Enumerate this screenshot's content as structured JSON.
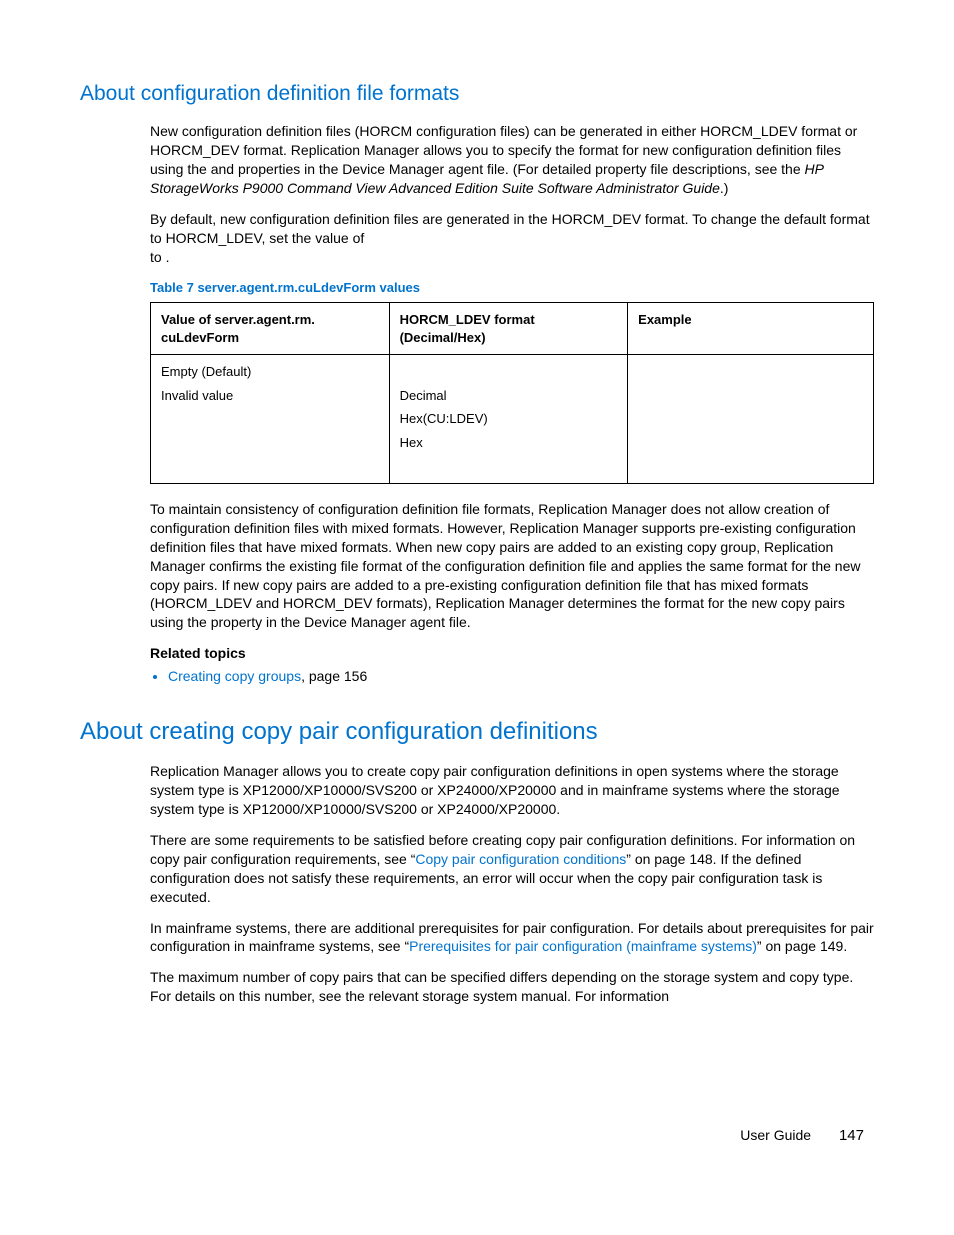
{
  "section1": {
    "heading": "About configuration definition file formats",
    "para1a": "New configuration definition files (HORCM configuration files) can be generated in either HORCM_LDEV format or HORCM_DEV format. Replication Manager allows you to specify the format for new configuration definition files using the ",
    "para1b": " and ",
    "para1c": " properties in the Device Manager agent ",
    "para1d": " file. (For detailed property file descriptions, see the ",
    "para1_italic": "HP StorageWorks P9000 Command View Advanced Edition Suite Software Administrator Guide",
    "para1e": ".)",
    "para2a": "By default, new configuration definition files are generated in the HORCM_DEV format. To change the default format to HORCM_LDEV, set the value of ",
    "para2b": " to ",
    "para2c": ".",
    "table_caption": "Table 7 server.agent.rm.cuLdevForm values",
    "table": {
      "h1": "Value of server.agent.rm. cuLdevForm",
      "h2": "HORCM_LDEV format (Decimal/Hex)",
      "h3": "Example",
      "c1_row1a": "Empty (Default)",
      "c1_row1b": "Invalid value",
      "c2_row1a": "Decimal",
      "c2_row1b": "Hex(CU:LDEV)",
      "c2_row1c": "Hex"
    },
    "para3a": "To maintain consistency of configuration definition file formats, Replication Manager does not allow creation of configuration definition files with mixed formats. However, Replication Manager supports pre-existing configuration definition files that have mixed formats. When new copy pairs are added to an existing copy group, Replication Manager confirms the existing file format of the configuration definition file and applies the same format for the new copy pairs. If new copy pairs are added to a pre-existing configuration definition file that has mixed formats (HORCM_LDEV and HORCM_DEV formats), Replication Manager determines the format for the new copy pairs using the ",
    "para3b": " property in the Device Manager agent ",
    "para3c": " file.",
    "related_heading": "Related topics",
    "related_link": "Creating copy groups",
    "related_suffix": ", page 156"
  },
  "section2": {
    "heading": "About creating copy pair configuration definitions",
    "para1": "Replication Manager allows you to create copy pair configuration definitions in open systems where the storage system type is XP12000/XP10000/SVS200 or XP24000/XP20000 and in mainframe systems where the storage system type is XP12000/XP10000/SVS200 or XP24000/XP20000.",
    "para2a": "There are some requirements to be satisfied before creating copy pair configuration definitions. For information on copy pair configuration requirements, see “",
    "para2_link": "Copy pair configuration conditions",
    "para2b": "” on page 148. If the defined configuration does not satisfy these requirements, an error will occur when the copy pair configuration task is executed.",
    "para3a": "In mainframe systems, there are additional prerequisites for pair configuration. For details about prerequisites for pair configuration in mainframe systems, see “",
    "para3_link": "Prerequisites for pair configuration (mainframe systems)",
    "para3b": "” on page 149.",
    "para4": "The maximum number of copy pairs that can be specified differs depending on the storage system and copy type. For details on this number, see the relevant storage system manual. For information"
  },
  "footer": {
    "label": "User Guide",
    "page": "147"
  }
}
